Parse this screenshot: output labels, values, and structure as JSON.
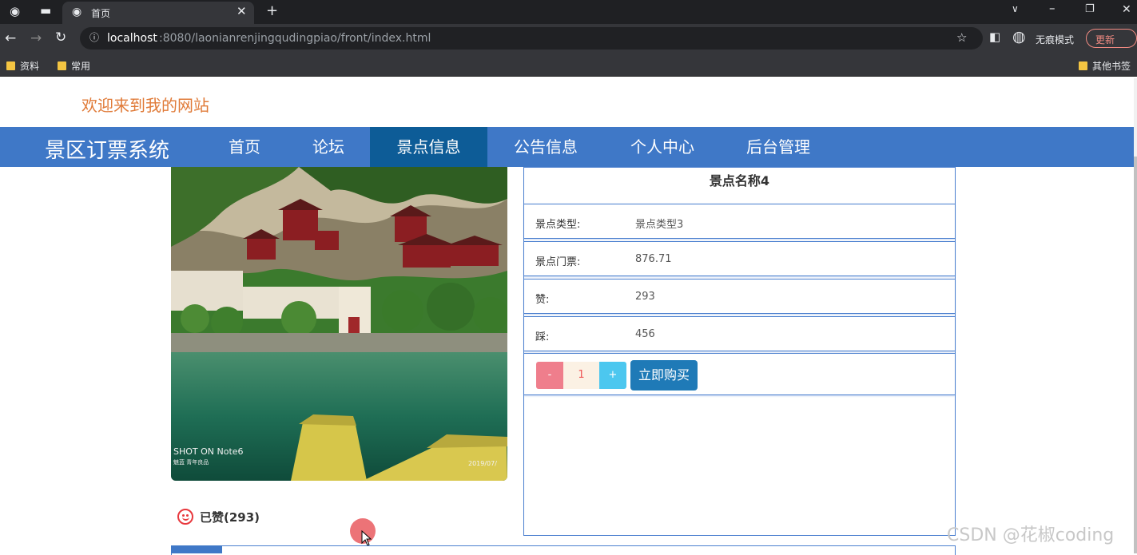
{
  "browser": {
    "tab_title": "首页",
    "url_host": "localhost",
    "url_rest": ":8080/laonianrenjingqudingpiao/front/index.html",
    "incognito_label": "无痕模式",
    "update_label": "更新",
    "bookmarks": [
      "资料",
      "常用"
    ],
    "other_bookmarks": "其他书签"
  },
  "site": {
    "welcome": "欢迎来到我的网站",
    "brand": "景区订票系统",
    "nav": [
      "首页",
      "论坛",
      "景点信息",
      "公告信息",
      "个人中心",
      "后台管理"
    ],
    "active_nav": "景点信息"
  },
  "photo": {
    "caption": "SHOT ON Note6",
    "caption_sub": "魅蓝 青年良品",
    "date": "2019/07/"
  },
  "detail": {
    "title": "景点名称4",
    "rows": [
      {
        "label": "景点类型:",
        "value": "景点类型3"
      },
      {
        "label": "景点门票:",
        "value": "876.71"
      },
      {
        "label": "赞:",
        "value": "293"
      },
      {
        "label": "踩:",
        "value": "456"
      }
    ],
    "minus": "-",
    "quantity": "1",
    "plus": "+",
    "buy_label": "立即购买"
  },
  "like": {
    "text": "已赞(293)"
  },
  "watermark": "CSDN @花椒coding",
  "colors": {
    "nav": "#3f78c7",
    "nav_active": "#0d5c97",
    "welcome": "#e07b39",
    "buy": "#1f7ab7"
  }
}
